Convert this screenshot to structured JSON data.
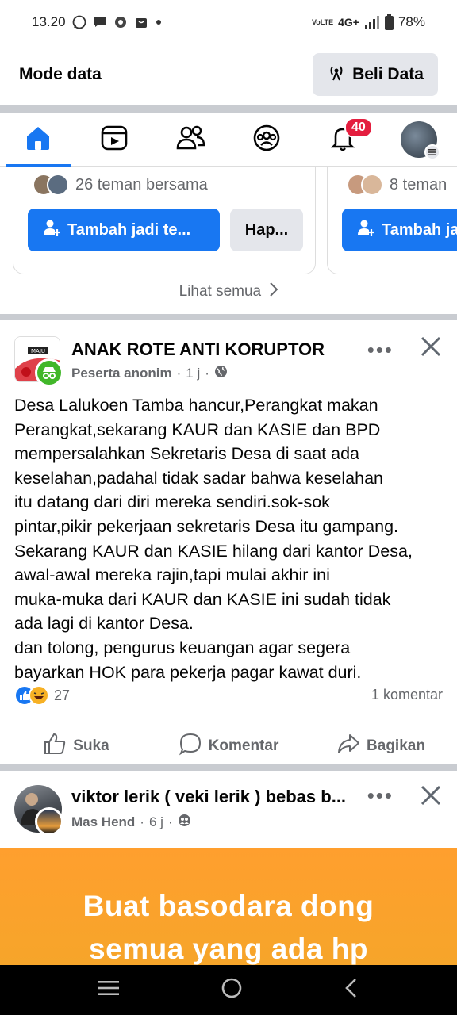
{
  "status_bar": {
    "time": "13.20",
    "network": "4G+",
    "volte": "VoLTE",
    "battery": "78%"
  },
  "data_mode": {
    "title": "Mode data",
    "buy_label": "Beli Data"
  },
  "nav": {
    "notifications_badge": "40",
    "active_color": "#1877f2"
  },
  "suggestions": {
    "cards": [
      {
        "mutual": "26 teman bersama",
        "add_label": "Tambah jadi te...",
        "remove_label": "Hap..."
      },
      {
        "mutual": "8 teman",
        "add_label": "Tambah ja"
      }
    ],
    "see_all": "Lihat semua"
  },
  "post1": {
    "group": "ANAK ROTE ANTI KORUPTOR",
    "author": "Peserta anonim",
    "time": "1 j",
    "body": "Desa Lalukoen Tamba hancur,Perangkat makan\nPerangkat,sekarang KAUR dan KASIE dan BPD\nmempersalahkan Sekretaris Desa di saat ada\nkeselahan,padahal tidak sadar bahwa keselahan\nitu datang dari diri mereka sendiri.sok-sok\npintar,pikir pekerjaan sekretaris Desa itu gampang.\nSekarang KAUR dan KASIE hilang dari kantor Desa,\nawal-awal mereka rajin,tapi mulai akhir ini\nmuka-muka dari KAUR dan KASIE ini sudah tidak\nada lagi di kantor Desa.\ndan tolong, pengurus keuangan agar segera\nbayarkan HOK para pekerja pagar kawat duri.",
    "reaction_count": "27",
    "comment_count": "1 komentar",
    "actions": {
      "like": "Suka",
      "comment": "Komentar",
      "share": "Bagikan"
    }
  },
  "post2": {
    "title": "viktor lerik ( veki lerik ) bebas b...",
    "author": "Mas Hend",
    "time": "6 j",
    "image_text_1": "Buat basodara dong",
    "image_text_2": "semua yang ada hp"
  }
}
